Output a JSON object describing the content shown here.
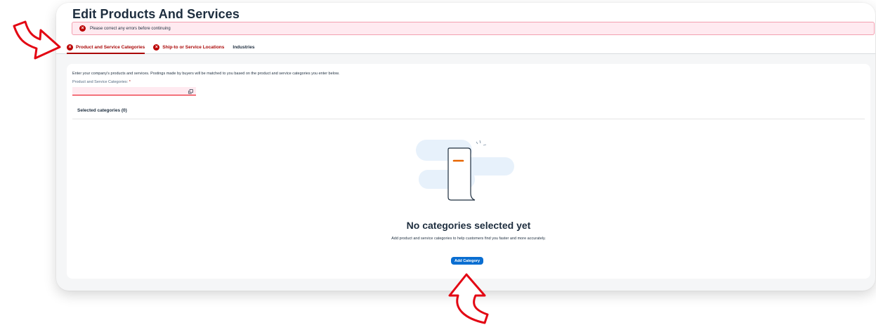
{
  "page": {
    "title": "Edit Products And Services",
    "error_message": "Please correct any errors before continuing"
  },
  "tabs": [
    {
      "label": "Product and Service Categories",
      "state": "error",
      "active": true
    },
    {
      "label": "Ship-to or Service Locations",
      "state": "error",
      "active": false
    },
    {
      "label": "Industries",
      "state": "normal",
      "active": false
    }
  ],
  "content": {
    "intro": "Enter your company's products and services. Postings made by buyers will be matched to you based on the product and service categories you enter below.",
    "field_label": "Product and Service Categories:",
    "required_marker": "*",
    "field_value": "",
    "selected_heading": "Selected categories (0)"
  },
  "empty_state": {
    "title": "No categories selected yet",
    "description": "Add product and service categories to help customers find you faster and more accurately.",
    "button_label": "Add Category"
  },
  "icons": {
    "error": "error-icon",
    "value_help": "value-help-icon",
    "illustration": "empty-document-illustration",
    "annotation": "red-arrow-annotation"
  },
  "colors": {
    "error_red": "#aa0808",
    "error_bg": "#ffeaf0",
    "button_blue": "#0a6ed1",
    "annotation_red": "#e30613",
    "illustration_bg": "#e7f1fb",
    "accent_orange": "#e76500"
  }
}
